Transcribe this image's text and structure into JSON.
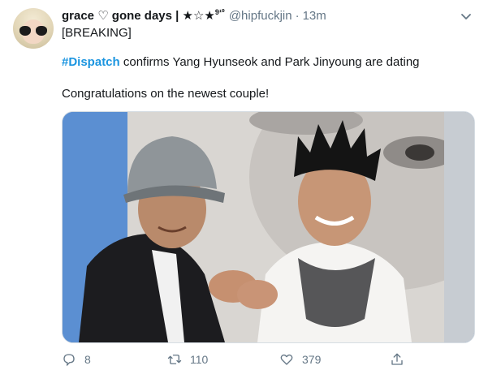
{
  "tweet": {
    "display_name": "grace ♡ gone days | ★☆★",
    "display_name_sup": "9¹⁰",
    "handle": "@hipfuckjin",
    "separator": "·",
    "time": "13m",
    "line1": "[BREAKING]",
    "hashtag": "#Dispatch",
    "line2_rest": " confirms Yang Hyunseok and Park Jinyoung are dating",
    "line3": "Congratulations on the newest couple!"
  },
  "actions": {
    "reply_count": "8",
    "retweet_count": "110",
    "like_count": "379"
  },
  "colors": {
    "link": "#1b95e0",
    "secondary_text": "#657786",
    "media_background": "#5a8fcf"
  },
  "icons": [
    "chevron-down-icon",
    "reply-icon",
    "retweet-icon",
    "like-icon",
    "share-icon"
  ]
}
